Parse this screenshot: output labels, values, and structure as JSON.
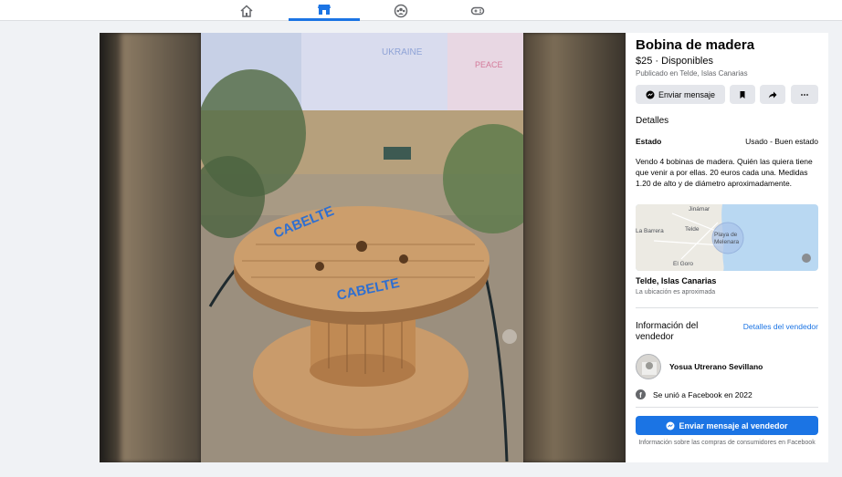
{
  "nav": {
    "tabs": [
      {
        "name": "home",
        "icon": "home-icon",
        "active": false
      },
      {
        "name": "marketplace",
        "icon": "marketplace-icon",
        "active": true
      },
      {
        "name": "groups",
        "icon": "groups-icon",
        "active": false
      },
      {
        "name": "gaming",
        "icon": "gaming-icon",
        "active": false
      }
    ]
  },
  "photo": {
    "wall_text_1": "UKRAINE",
    "wall_text_2": "PEACE",
    "spool_text": "CABELTE"
  },
  "listing": {
    "title": "Bobina de madera",
    "price": "$25 · Disponibles",
    "published": "Publicado en Telde, Islas Canarias",
    "message_button": "Enviar mensaje",
    "details_heading": "Detalles",
    "condition_label": "Estado",
    "condition_value": "Usado - Buen estado",
    "description": "Vendo 4 bobinas de madera. Quién las quiera tiene que venir a por ellas. 20 euros cada una. Medidas 1.20 de alto y de diámetro aproximadamente.",
    "location": "Telde, Islas Canarias",
    "location_note": "La ubicación es aproximada"
  },
  "map": {
    "labels": {
      "jinamar": "Jinámar",
      "la_barrera": "La Barrera",
      "telde": "Telde",
      "playa_1": "Playa de",
      "playa_2": "Melenara",
      "el_goro": "El Goro"
    }
  },
  "seller": {
    "heading": "Información del vendedor",
    "details_link": "Detalles del vendedor",
    "name": "Yosua Utrerano Sevillano",
    "joined": "Se unió a Facebook en 2022",
    "send_button": "Enviar mensaje al vendedor",
    "info_note": "Información sobre las compras de consumidores en Facebook"
  },
  "colors": {
    "accent": "#1b74e4",
    "secondary_text": "#65676b"
  }
}
